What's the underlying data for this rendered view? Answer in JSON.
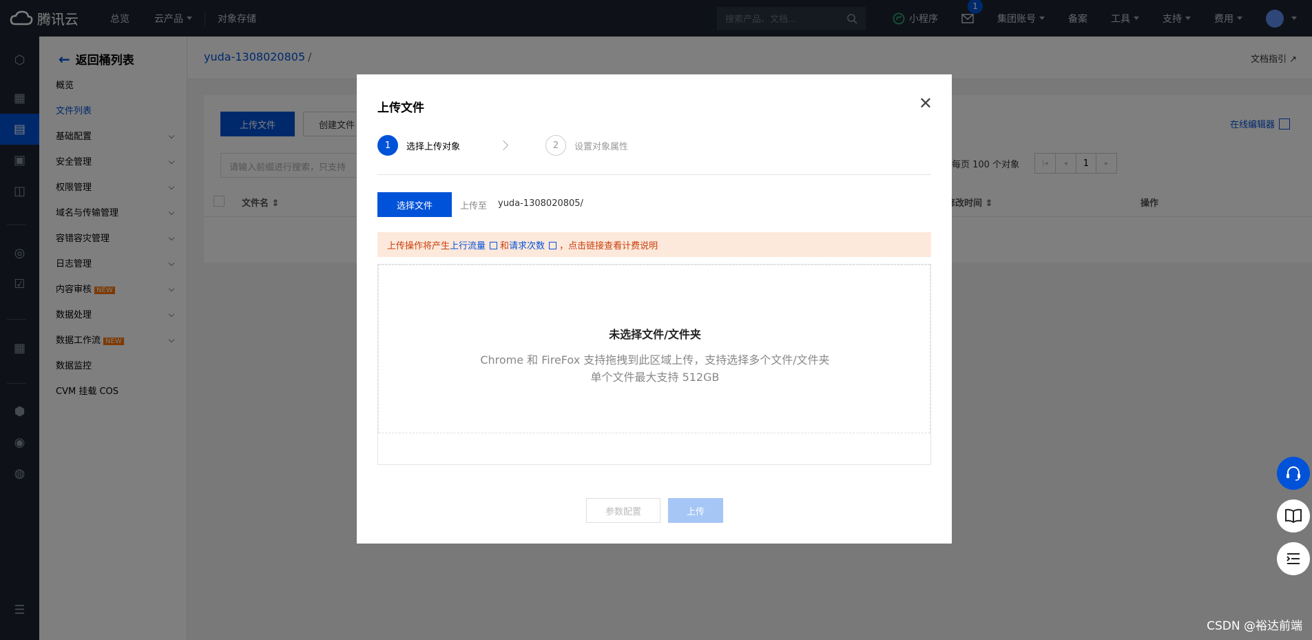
{
  "topnav": {
    "brand": "腾讯云",
    "items": [
      {
        "label": "总览",
        "caret": false
      },
      {
        "label": "云产品",
        "caret": true
      },
      {
        "label": "对象存储",
        "caret": false
      }
    ],
    "search_placeholder": "搜索产品、文档...",
    "right": [
      {
        "label": "小程序",
        "caret": false
      },
      {
        "label": "",
        "caret": false,
        "badge": "1"
      },
      {
        "label": "集团账号",
        "caret": true
      },
      {
        "label": "备案",
        "caret": false
      },
      {
        "label": "工具",
        "caret": true
      },
      {
        "label": "支持",
        "caret": true
      },
      {
        "label": "费用",
        "caret": true
      }
    ]
  },
  "sidebar": {
    "back_label": "返回桶列表",
    "items": [
      {
        "label": "概览",
        "expandable": false,
        "active": false
      },
      {
        "label": "文件列表",
        "expandable": false,
        "active": true
      },
      {
        "label": "基础配置",
        "expandable": true
      },
      {
        "label": "安全管理",
        "expandable": true
      },
      {
        "label": "权限管理",
        "expandable": true
      },
      {
        "label": "域名与传输管理",
        "expandable": true
      },
      {
        "label": "容错容灾管理",
        "expandable": true
      },
      {
        "label": "日志管理",
        "expandable": true
      },
      {
        "label": "内容审核",
        "expandable": true,
        "tag": "NEW"
      },
      {
        "label": "数据处理",
        "expandable": true
      },
      {
        "label": "数据工作流",
        "expandable": true,
        "tag": "NEW"
      },
      {
        "label": "数据监控",
        "expandable": false
      },
      {
        "label": "CVM 挂载 COS",
        "expandable": false
      }
    ]
  },
  "breadcrumb": {
    "bucket": "yuda-1308020805",
    "separator": "/",
    "doc_link": "文档指引"
  },
  "panel": {
    "upload_button": "上传文件",
    "create_button": "创建文件",
    "search_placeholder": "请输入前缀进行搜索，只支持",
    "online_editor": "在线编辑器",
    "per_page": "每页 100 个对象",
    "page": "1",
    "columns": {
      "name": "文件名",
      "modified": "修改时间",
      "actions": "操作"
    }
  },
  "modal": {
    "title": "上传文件",
    "steps": [
      {
        "num": "1",
        "label": "选择上传对象",
        "active": true
      },
      {
        "num": "2",
        "label": "设置对象属性",
        "active": false
      }
    ],
    "select_button": "选择文件",
    "upload_to_label": "上传至",
    "upload_path": "yuda-1308020805/",
    "notice": {
      "prefix": "上传操作将产生",
      "link1": "上行流量",
      "middle": "和",
      "link2": "请求次数",
      "suffix": "，点击链接查看计费说明"
    },
    "drop": {
      "title": "未选择文件/文件夹",
      "line1": "Chrome 和 FireFox 支持拖拽到此区域上传，支持选择多个文件/文件夹",
      "line2": "单个文件最大支持 512GB"
    },
    "config_button": "参数配置",
    "upload_button": "上传"
  },
  "watermark": "CSDN @裕达前端"
}
